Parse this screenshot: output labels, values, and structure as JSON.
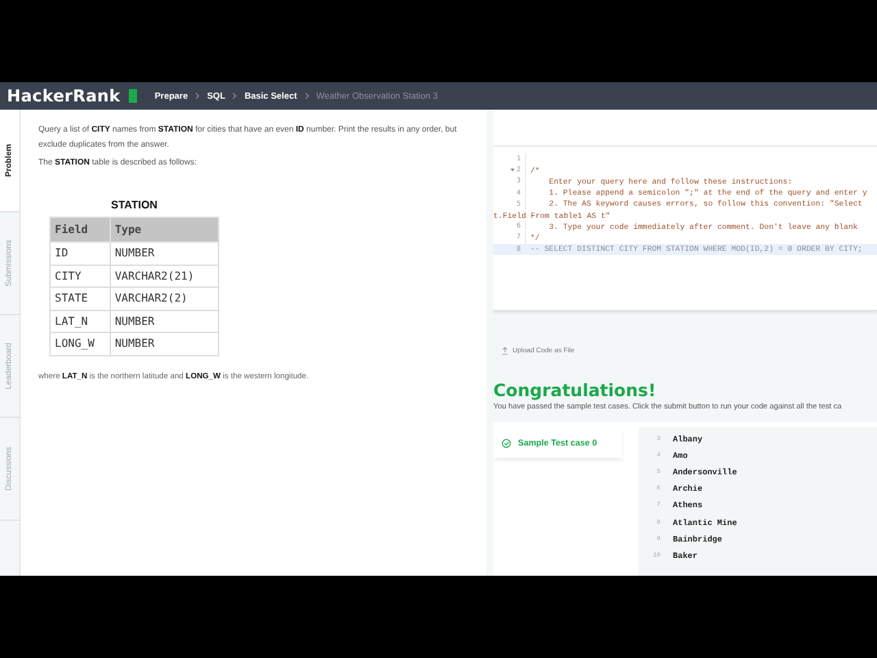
{
  "header": {
    "logo": "HackerRank",
    "breadcrumbs": [
      {
        "label": "Prepare",
        "current": false
      },
      {
        "label": "SQL",
        "current": false
      },
      {
        "label": "Basic Select",
        "current": false
      },
      {
        "label": "Weather Observation Station 3",
        "current": true
      }
    ]
  },
  "side_tabs": [
    {
      "label": "Problem",
      "selected": true
    },
    {
      "label": "Submissions",
      "selected": false
    },
    {
      "label": "Leaderboard",
      "selected": false
    },
    {
      "label": "Discussions",
      "selected": false
    }
  ],
  "problem": {
    "paragraphs": [
      "Query a list of **CITY** names from **STATION** for cities that have an even **ID** number. Print the results in any order, but exclude duplicates from the answer.",
      "The **STATION** table is described as follows:"
    ],
    "table": {
      "title": "STATION",
      "columns": [
        "Field",
        "Type"
      ],
      "rows": [
        [
          "ID",
          "NUMBER"
        ],
        [
          "CITY",
          "VARCHAR2(21)"
        ],
        [
          "STATE",
          "VARCHAR2(2)"
        ],
        [
          "LAT_N",
          "NUMBER"
        ],
        [
          "LONG_W",
          "NUMBER"
        ]
      ]
    },
    "note": "where **LAT_N** is the northern latitude and **LONG_W** is the western longitude."
  },
  "editor": {
    "lines": [
      {
        "number": "1",
        "foldable": false,
        "selected": false
      },
      {
        "number": "2",
        "text": "/*",
        "foldable": true,
        "selected": false
      },
      {
        "number": "3",
        "text": "    Enter your query here and follow these instructions:",
        "foldable": false,
        "selected": false
      },
      {
        "number": "4",
        "text": "    1. Please append a semicolon \";\" at the end of the query and enter y",
        "foldable": false,
        "selected": false
      },
      {
        "number": "5",
        "text": "    2. The AS keyword causes errors, so follow this convention: \"Select",
        "continuation": "t.Field From table1 AS t\"",
        "foldable": false,
        "selected": false
      },
      {
        "number": "6",
        "text": "    3. Type your code immediately after comment. Don't leave any blank",
        "foldable": false,
        "selected": false
      },
      {
        "number": "7",
        "text": "*/",
        "foldable": false,
        "selected": false
      },
      {
        "number": "8",
        "text": "-- SELECT DISTINCT CITY FROM STATION WHERE MOD(ID,2) = 0 ORDER BY CITY;",
        "foldable": false,
        "selected": true
      }
    ]
  },
  "upload_link": "Upload Code as File",
  "result": {
    "title": "Congratulations!",
    "message": "You have passed the sample test cases. Click the submit button to run your code against all the test ca",
    "test_cases": [
      {
        "label": "Sample Test case 0",
        "passed": true,
        "selected": true
      }
    ],
    "output": [
      {
        "number": "3",
        "text": "Albany"
      },
      {
        "number": "4",
        "text": "Amo"
      },
      {
        "number": "5",
        "text": "Andersonville"
      },
      {
        "number": "6",
        "text": "Archie"
      },
      {
        "number": "7",
        "text": "Athens"
      },
      {
        "number": "8",
        "text": "Atlantic Mine"
      },
      {
        "number": "9",
        "text": "Bainbridge"
      },
      {
        "number": "10",
        "text": "Baker"
      }
    ]
  }
}
